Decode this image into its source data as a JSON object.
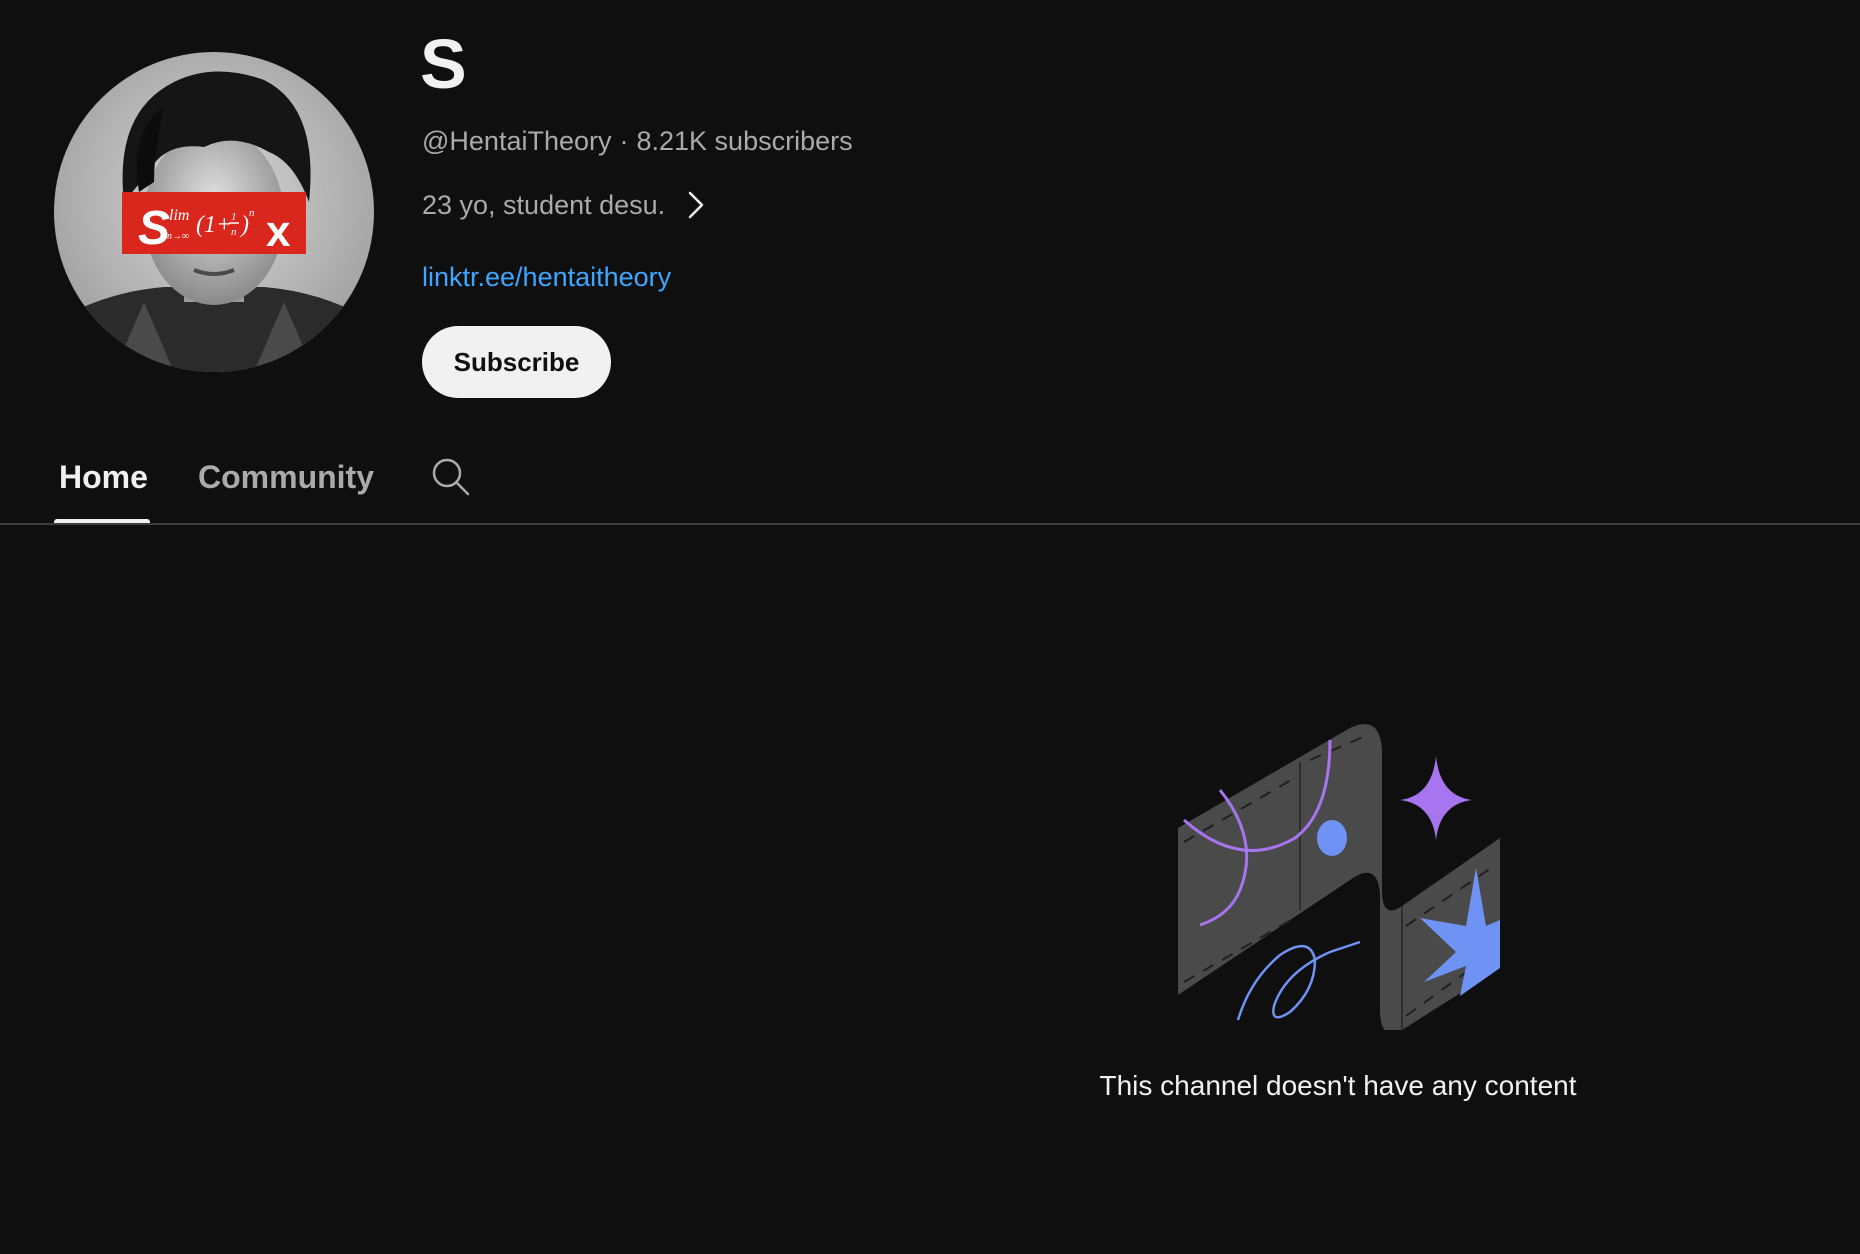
{
  "channel": {
    "name": "S",
    "handle": "@HentaiTheory",
    "separator": "·",
    "subscribers": "8.21K subscribers",
    "description": "23 yo, student desu.",
    "link": "linktr.ee/hentaitheory",
    "avatar_banner_text": "S lim(1+1/n)^n x"
  },
  "actions": {
    "subscribe_label": "Subscribe"
  },
  "tabs": [
    {
      "label": "Home",
      "active": true
    },
    {
      "label": "Community",
      "active": false
    }
  ],
  "empty_state": {
    "message": "This channel doesn't have any content",
    "illustration_icon": "empty-channel-illustration"
  },
  "icons": {
    "description_more": "chevron-right-icon",
    "tab_search": "search-icon"
  },
  "colors": {
    "background": "#0f0f0f",
    "text_primary": "#f1f1f1",
    "text_secondary": "#aaaaaa",
    "link": "#3ea6ff",
    "subscribe_bg": "#f1f1f1",
    "accent_purple": "#a775f0",
    "accent_blue": "#6f93f5"
  }
}
